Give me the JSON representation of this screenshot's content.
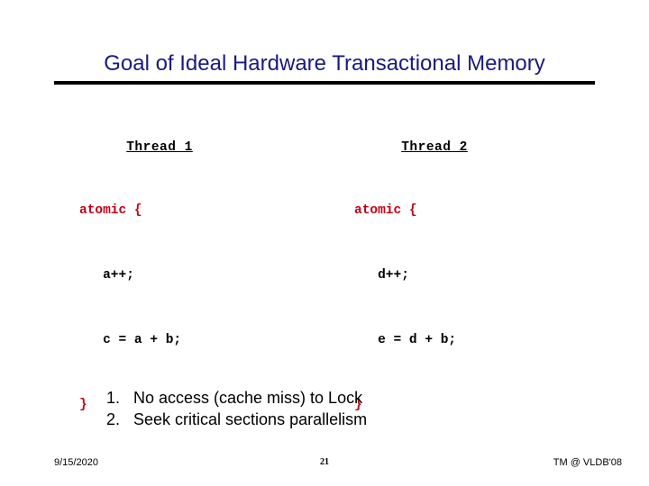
{
  "slide": {
    "title": "Goal of Ideal Hardware Transactional Memory",
    "title_color": "#1a1a80",
    "rule_color": "#000000",
    "background": "#ffffff",
    "keyword_color": "#c00018"
  },
  "columns": [
    {
      "label": "Thread 1",
      "lines": [
        {
          "text": "atomic {",
          "kind": "kw"
        },
        {
          "text": "   a++;",
          "kind": "stmt"
        },
        {
          "text": "   c = a + b;",
          "kind": "stmt"
        },
        {
          "text": "}",
          "kind": "kw"
        }
      ]
    },
    {
      "label": "Thread 2",
      "lines": [
        {
          "text": "atomic {",
          "kind": "kw"
        },
        {
          "text": "   d++;",
          "kind": "stmt"
        },
        {
          "text": "   e = d + b;",
          "kind": "stmt"
        },
        {
          "text": "}",
          "kind": "kw"
        }
      ]
    }
  ],
  "points": [
    {
      "num": "1.",
      "text": "No access (cache miss) to Lock"
    },
    {
      "num": "2.",
      "text": "Seek critical sections parallelism"
    }
  ],
  "footer": {
    "date": "9/15/2020",
    "page_number": "21",
    "right_text": "TM @ VLDB'08"
  }
}
